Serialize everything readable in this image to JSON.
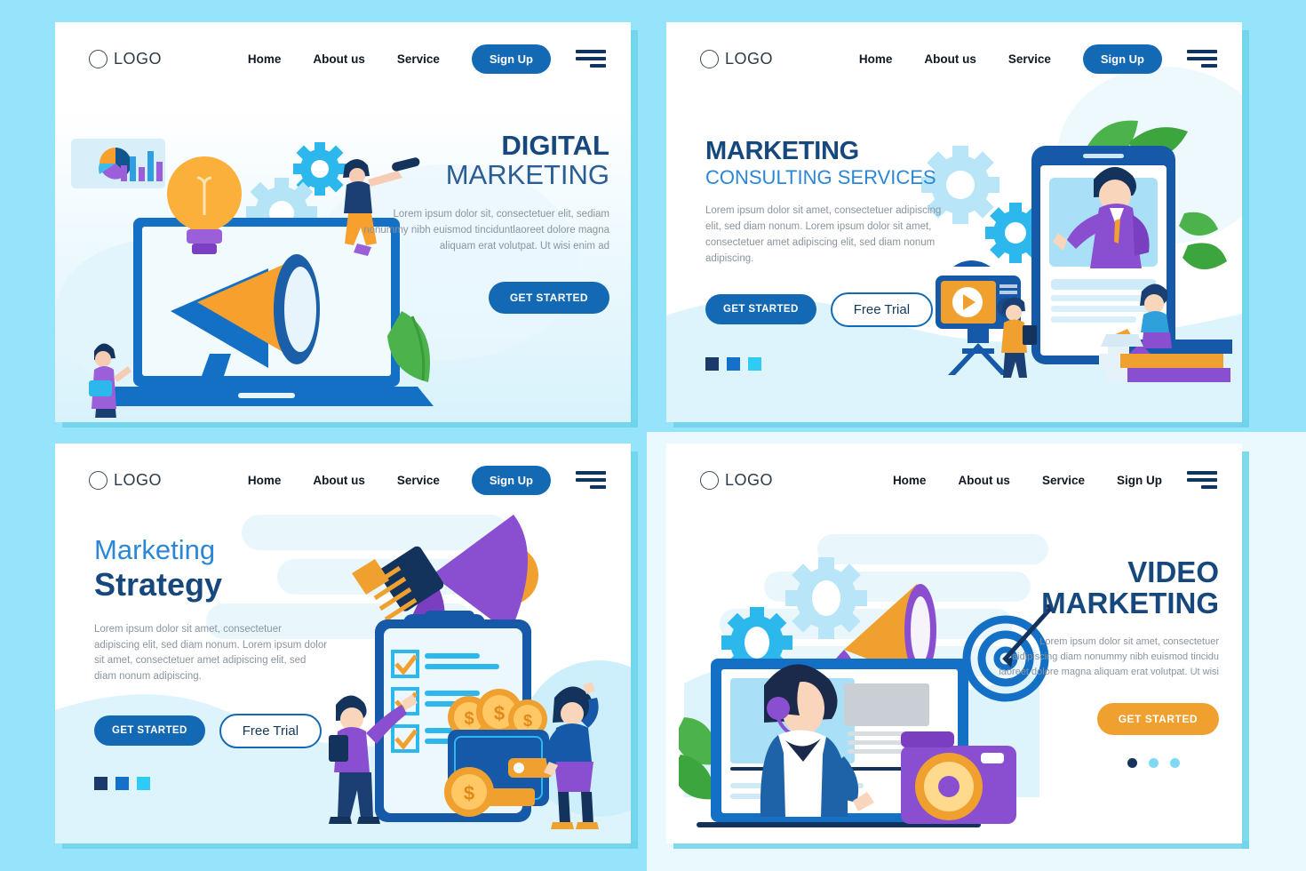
{
  "page": {
    "background_color": "#95e4fb",
    "card_background": "#ffffff",
    "card_shadow_color": "#6fd3ea",
    "accent_blue": "#1469b5",
    "accent_dark_blue": "#16487e",
    "accent_light_blue": "#2b87d6",
    "accent_orange": "#f0a02e",
    "body_text_color": "#8a949e"
  },
  "cards": [
    {
      "id": "digital-marketing",
      "nav": {
        "logo": "LOGO",
        "links": [
          "Home",
          "About us",
          "Service"
        ],
        "signup_label": "Sign Up",
        "signup_is_button": true,
        "menu_icon": "hamburger-icon"
      },
      "title_line1": "DIGITAL",
      "title_line2": "MARKETING",
      "body": "Lorem ipsum dolor sit, consectetuer elit, sediam nonummy nibh euismod  tinciduntlaoreet dolore magna aliquam erat volutpat. Ut wisi enim ad",
      "buttons": [
        {
          "label": "GET STARTED",
          "style": "primary"
        }
      ],
      "dots": null
    },
    {
      "id": "marketing-consulting-services",
      "nav": {
        "logo": "LOGO",
        "links": [
          "Home",
          "About us",
          "Service"
        ],
        "signup_label": "Sign Up",
        "signup_is_button": true,
        "menu_icon": "hamburger-icon"
      },
      "title_line1": "MARKETING",
      "title_line2": "CONSULTING SERVICES",
      "body": "Lorem ipsum dolor sit amet, consectetuer adipiscing elit, sed diam nonum. Lorem ipsum dolor sit amet, consectetuer amet adipiscing elit, sed diam nonum adipiscing.",
      "buttons": [
        {
          "label": "GET STARTED",
          "style": "primary"
        },
        {
          "label": "Free Trial",
          "style": "outline"
        }
      ],
      "dots": {
        "shape": "square",
        "colors": [
          "#1b3a6b",
          "#1570cc",
          "#2ecbf5"
        ]
      }
    },
    {
      "id": "marketing-strategy",
      "nav": {
        "logo": "LOGO",
        "links": [
          "Home",
          "About us",
          "Service"
        ],
        "signup_label": "Sign Up",
        "signup_is_button": true,
        "menu_icon": "hamburger-icon"
      },
      "title_line1": "Marketing",
      "title_line2": "Strategy",
      "body": "Lorem ipsum dolor sit amet, consectetuer adipiscing elit, sed diam nonum. Lorem ipsum dolor sit amet, consectetuer amet adipiscing elit, sed diam nonum adipiscing.",
      "buttons": [
        {
          "label": "GET STARTED",
          "style": "primary"
        },
        {
          "label": "Free Trial",
          "style": "outline"
        }
      ],
      "dots": {
        "shape": "square",
        "colors": [
          "#1b3a6b",
          "#1570cc",
          "#2ecbf5"
        ]
      }
    },
    {
      "id": "video-marketing",
      "nav": {
        "logo": "LOGO",
        "links": [
          "Home",
          "About us",
          "Service"
        ],
        "signup_label": "Sign Up",
        "signup_is_button": false,
        "menu_icon": "hamburger-icon"
      },
      "title_line1": "VIDEO",
      "title_line2": "MARKETING",
      "body": "Lorem ipsum dolor sit amet, consectetuer aidipiscing diam nonummy nibh euismod tincidu laoreet dolore magna aliquam erat volutpat. Ut wisi",
      "buttons": [
        {
          "label": "GET STARTED",
          "style": "orange"
        }
      ],
      "dots": {
        "shape": "round",
        "colors": [
          "#16335c",
          "#7fd9f2",
          "#7fd9f2"
        ]
      }
    }
  ]
}
